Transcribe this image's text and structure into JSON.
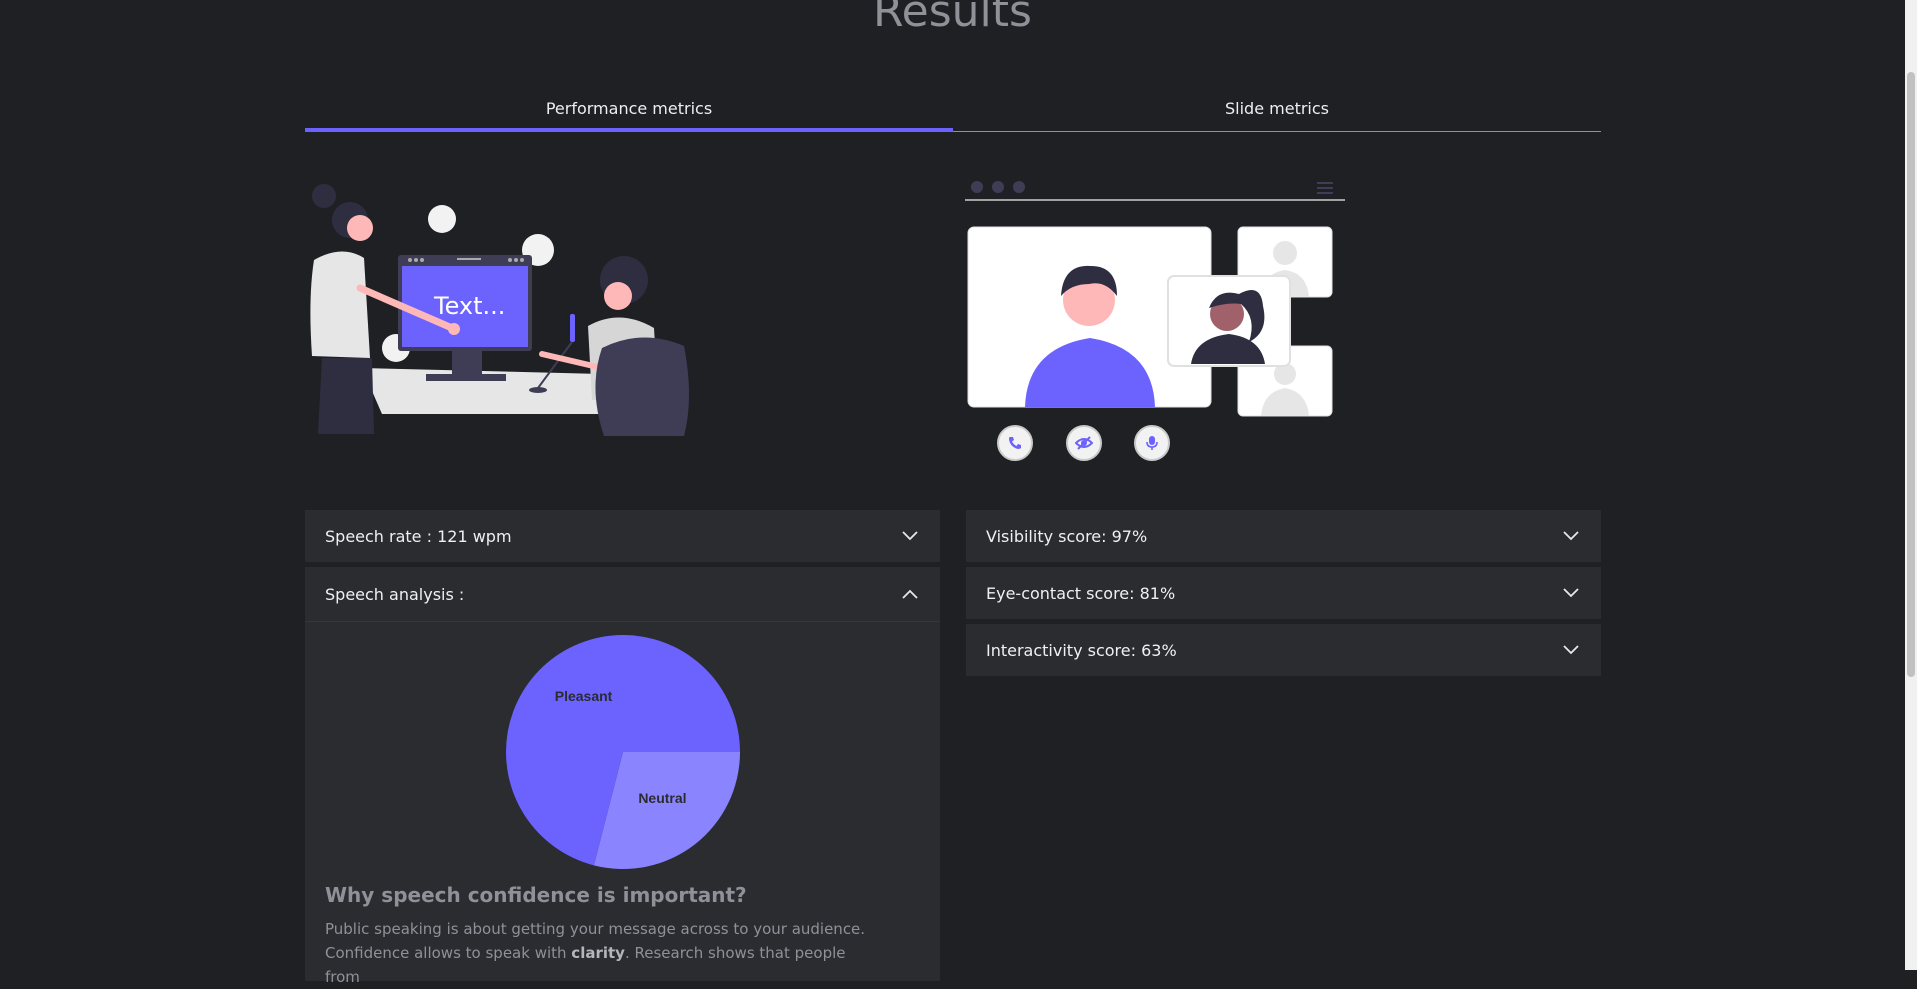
{
  "page": {
    "title": "Results"
  },
  "tabs": [
    {
      "label": "Performance metrics",
      "active": true
    },
    {
      "label": "Slide metrics",
      "active": false
    }
  ],
  "illustration_left": {
    "screen_text": "Text..."
  },
  "left_accordions": {
    "speech_rate": {
      "label": "Speech rate : 121 wpm",
      "expanded": false
    },
    "speech_analysis": {
      "label": "Speech analysis :",
      "expanded": true
    }
  },
  "right_accordions": [
    {
      "label": "Visibility score: 97%",
      "expanded": false
    },
    {
      "label": "Eye-contact score: 81%",
      "expanded": false
    },
    {
      "label": "Interactivity score: 63%",
      "expanded": false
    }
  ],
  "chart_data": {
    "type": "pie",
    "slices": [
      {
        "label": "Pleasant",
        "value": 71,
        "color": "#6c63ff"
      },
      {
        "label": "Neutral",
        "value": 29,
        "color": "#8b84ff"
      }
    ]
  },
  "why": {
    "title": "Why speech confidence is important?",
    "text_1": "Public speaking is about getting your message across to your audience. Confidence allows to speak with ",
    "bold": "clarity",
    "text_2": ". Research shows that people from"
  },
  "colors": {
    "accent": "#6c63ff",
    "background": "#1f2024",
    "card": "#2a2c30"
  },
  "icons": [
    "chevron-down-icon",
    "chevron-up-icon",
    "phone-icon",
    "eye-off-icon",
    "microphone-icon",
    "menu-icon"
  ]
}
